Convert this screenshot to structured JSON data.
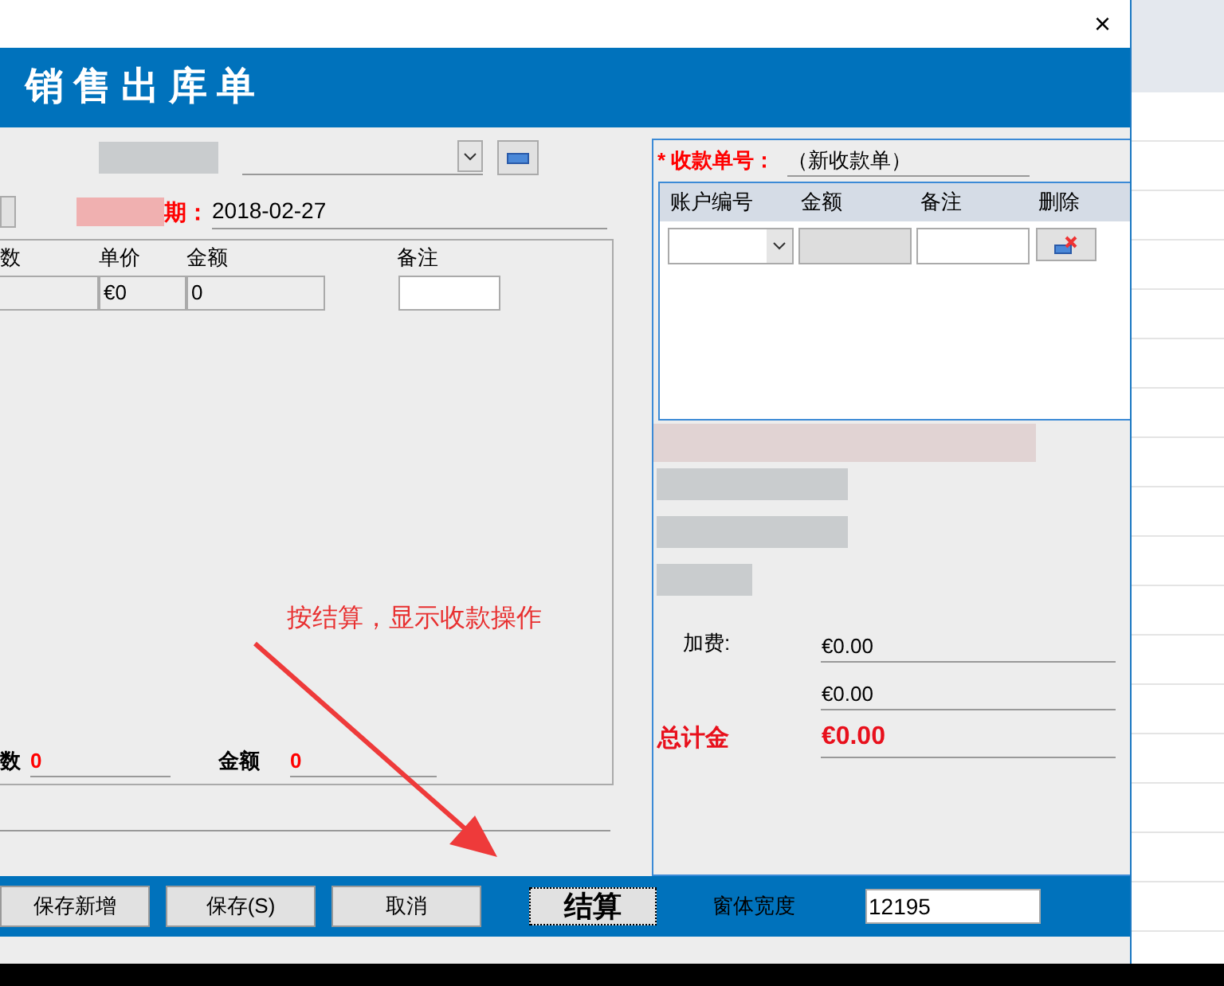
{
  "window": {
    "title": "销售出库单",
    "close": "×"
  },
  "order": {
    "date_label": "期：",
    "date": "2018-02-27"
  },
  "items_table": {
    "columns": [
      "数",
      "单价",
      "金额",
      "备注"
    ],
    "rows": [
      {
        "price": "€0",
        "amount": "0"
      }
    ]
  },
  "totals": [
    {
      "label": "数",
      "value": "0"
    },
    {
      "label": "金额",
      "value": "0"
    }
  ],
  "receipt": {
    "label": "* 收款单号：",
    "number": "（新收款单）",
    "columns": [
      "账户编号",
      "金额",
      "备注",
      "删除"
    ],
    "fields": [
      {
        "kind": "plain",
        "label": "加费:",
        "value": "€0.00"
      },
      {
        "kind": "plain",
        "value": "€0.00"
      },
      {
        "kind": "total",
        "label": "总计金",
        "value": "€0.00"
      }
    ]
  },
  "annotation": "按结算，显示收款操作",
  "buttons": [
    {
      "label": "保存新增",
      "kind": "normal"
    },
    {
      "label": "保存(S)",
      "kind": "normal"
    },
    {
      "label": "取消",
      "kind": "normal"
    },
    {
      "label": "结算",
      "kind": "primary"
    }
  ],
  "width_field": {
    "label": "窗体宽度",
    "value": "12195"
  }
}
